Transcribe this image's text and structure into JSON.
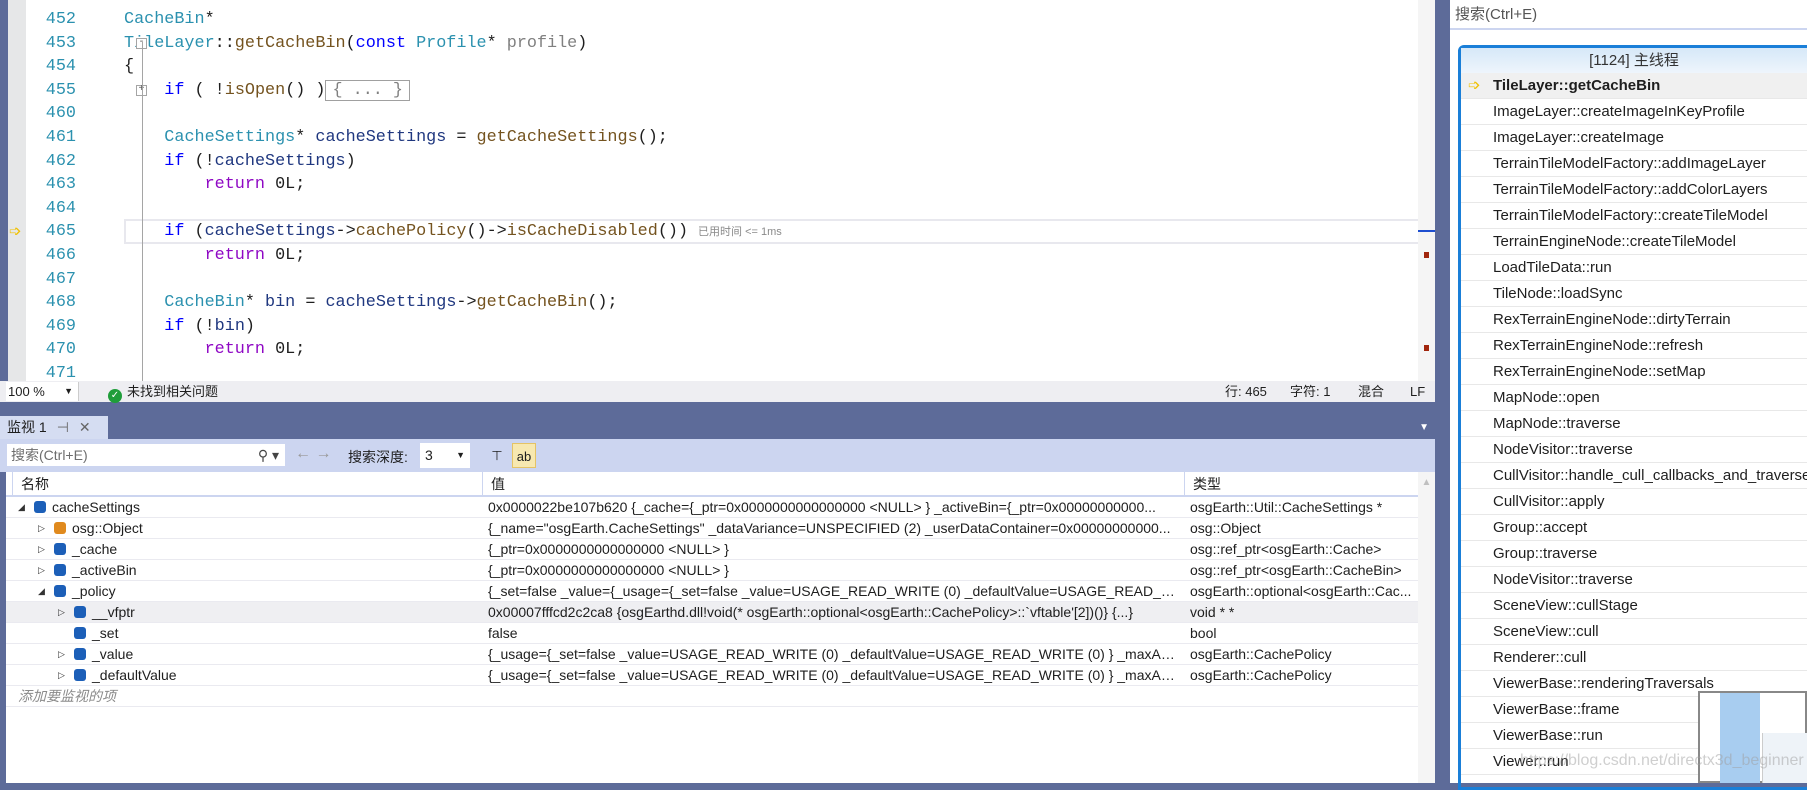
{
  "colors": {
    "accent": "#1a7fd8",
    "chrome": "#5d6b99",
    "toolbar": "#ccd5f0"
  },
  "editor": {
    "current_line": "465",
    "lines": [
      {
        "num": "452",
        "tokens": [
          {
            "t": "CacheBin",
            "c": "ty"
          },
          {
            "t": "*",
            "c": "pl"
          }
        ]
      },
      {
        "num": "453",
        "tokens": [
          {
            "t": "TileLayer",
            "c": "ty"
          },
          {
            "t": "::",
            "c": "pl"
          },
          {
            "t": "getCacheBin",
            "c": "fn"
          },
          {
            "t": "(",
            "c": "pl"
          },
          {
            "t": "const",
            "c": "kw"
          },
          {
            "t": " ",
            "c": "pl"
          },
          {
            "t": "Profile",
            "c": "ty"
          },
          {
            "t": "* ",
            "c": "pl"
          },
          {
            "t": "profile",
            "c": "pa"
          },
          {
            "t": ")",
            "c": "pl"
          }
        ]
      },
      {
        "num": "454",
        "tokens": [
          {
            "t": "{",
            "c": "pl"
          }
        ]
      },
      {
        "num": "455",
        "tokens": [
          {
            "t": "    ",
            "c": "pl"
          },
          {
            "t": "if",
            "c": "kw"
          },
          {
            "t": " ( !",
            "c": "pl"
          },
          {
            "t": "isOpen",
            "c": "fn"
          },
          {
            "t": "() )",
            "c": "pl"
          },
          {
            "t": "{ ... }",
            "c": "collapsed"
          }
        ]
      },
      {
        "num": "460",
        "tokens": []
      },
      {
        "num": "461",
        "tokens": [
          {
            "t": "    ",
            "c": "pl"
          },
          {
            "t": "CacheSettings",
            "c": "ty"
          },
          {
            "t": "* ",
            "c": "pl"
          },
          {
            "t": "cacheSettings",
            "c": "va"
          },
          {
            "t": " = ",
            "c": "pl"
          },
          {
            "t": "getCacheSettings",
            "c": "fn"
          },
          {
            "t": "();",
            "c": "pl"
          }
        ]
      },
      {
        "num": "462",
        "tokens": [
          {
            "t": "    ",
            "c": "pl"
          },
          {
            "t": "if",
            "c": "kw"
          },
          {
            "t": " (!",
            "c": "pl"
          },
          {
            "t": "cacheSettings",
            "c": "va"
          },
          {
            "t": ")",
            "c": "pl"
          }
        ]
      },
      {
        "num": "463",
        "tokens": [
          {
            "t": "        ",
            "c": "pl"
          },
          {
            "t": "return",
            "c": "rt"
          },
          {
            "t": " 0L;",
            "c": "pl"
          }
        ]
      },
      {
        "num": "464",
        "tokens": []
      },
      {
        "num": "465",
        "tokens": [
          {
            "t": "    ",
            "c": "pl"
          },
          {
            "t": "if",
            "c": "kw"
          },
          {
            "t": " (",
            "c": "pl"
          },
          {
            "t": "cacheSettings",
            "c": "va"
          },
          {
            "t": "->",
            "c": "pl"
          },
          {
            "t": "cachePolicy",
            "c": "fn"
          },
          {
            "t": "()->",
            "c": "pl"
          },
          {
            "t": "isCacheDisabled",
            "c": "fn"
          },
          {
            "t": "())",
            "c": "pl"
          },
          {
            "t": "已用时间 <= 1ms",
            "c": "hint"
          }
        ]
      },
      {
        "num": "466",
        "tokens": [
          {
            "t": "        ",
            "c": "pl"
          },
          {
            "t": "return",
            "c": "rt"
          },
          {
            "t": " 0L;",
            "c": "pl"
          }
        ]
      },
      {
        "num": "467",
        "tokens": []
      },
      {
        "num": "468",
        "tokens": [
          {
            "t": "    ",
            "c": "pl"
          },
          {
            "t": "CacheBin",
            "c": "ty"
          },
          {
            "t": "* ",
            "c": "pl"
          },
          {
            "t": "bin",
            "c": "va"
          },
          {
            "t": " = ",
            "c": "pl"
          },
          {
            "t": "cacheSettings",
            "c": "va"
          },
          {
            "t": "->",
            "c": "pl"
          },
          {
            "t": "getCacheBin",
            "c": "fn"
          },
          {
            "t": "();",
            "c": "pl"
          }
        ]
      },
      {
        "num": "469",
        "tokens": [
          {
            "t": "    ",
            "c": "pl"
          },
          {
            "t": "if",
            "c": "kw"
          },
          {
            "t": " (!",
            "c": "pl"
          },
          {
            "t": "bin",
            "c": "va"
          },
          {
            "t": ")",
            "c": "pl"
          }
        ]
      },
      {
        "num": "470",
        "tokens": [
          {
            "t": "        ",
            "c": "pl"
          },
          {
            "t": "return",
            "c": "rt"
          },
          {
            "t": " 0L;",
            "c": "pl"
          }
        ]
      },
      {
        "num": "471",
        "tokens": []
      }
    ]
  },
  "status": {
    "zoom": "100 %",
    "issues": "未找到相关问题",
    "line": "行: 465",
    "char": "字符: 1",
    "mode": "混合",
    "eol": "LF"
  },
  "watch": {
    "tab": "监视 1",
    "search_placeholder": "搜索(Ctrl+E)",
    "depth_label": "搜索深度:",
    "depth": "3",
    "columns": [
      "名称",
      "值",
      "类型"
    ],
    "rows": [
      {
        "level": 0,
        "exp": "open",
        "icon": "object",
        "name": "cacheSettings",
        "value": "0x0000022be107b620 {_cache={_ptr=0x0000000000000000 <NULL> } _activeBin={_ptr=0x00000000000...",
        "type": "osgEarth::Util::CacheSettings *"
      },
      {
        "level": 1,
        "exp": "closed",
        "icon": "base",
        "name": "osg::Object",
        "value": "{_name=\"osgEarth.CacheSettings\" _dataVariance=UNSPECIFIED (2) _userDataContainer=0x00000000000...",
        "type": "osg::Object"
      },
      {
        "level": 1,
        "exp": "closed",
        "icon": "field",
        "name": "_cache",
        "value": "{_ptr=0x0000000000000000 <NULL> }",
        "type": "osg::ref_ptr<osgEarth::Cache>"
      },
      {
        "level": 1,
        "exp": "closed",
        "icon": "field",
        "name": "_activeBin",
        "value": "{_ptr=0x0000000000000000 <NULL> }",
        "type": "osg::ref_ptr<osgEarth::CacheBin>"
      },
      {
        "level": 1,
        "exp": "open",
        "icon": "field",
        "name": "_policy",
        "value": "{_set=false _value={_usage={_set=false _value=USAGE_READ_WRITE (0) _defaultValue=USAGE_READ_W...",
        "type": "osgEarth::optional<osgEarth::Cac..."
      },
      {
        "level": 2,
        "exp": "closed",
        "icon": "object",
        "name": "__vfptr",
        "value": "0x00007fffcd2c2ca8 {osgEarthd.dll!void(* osgEarth::optional<osgEarth::CachePolicy>::`vftable'[2])()} {...}",
        "type": "void * *",
        "selected": true
      },
      {
        "level": 2,
        "exp": "none",
        "icon": "protected",
        "name": "_set",
        "value": "false",
        "type": "bool"
      },
      {
        "level": 2,
        "exp": "closed",
        "icon": "protected",
        "name": "_value",
        "value": "{_usage={_set=false _value=USAGE_READ_WRITE (0) _defaultValue=USAGE_READ_WRITE (0) } _maxAge...",
        "type": "osgEarth::CachePolicy"
      },
      {
        "level": 2,
        "exp": "closed",
        "icon": "protected",
        "name": "_defaultValue",
        "value": "{_usage={_set=false _value=USAGE_READ_WRITE (0) _defaultValue=USAGE_READ_WRITE (0) } _maxAge...",
        "type": "osgEarth::CachePolicy"
      }
    ],
    "add_item": "添加要监视的项"
  },
  "callstack": {
    "search_placeholder": "搜索(Ctrl+E)",
    "thread": "[1124] 主线程",
    "frames": [
      "TileLayer::getCacheBin",
      "ImageLayer::createImageInKeyProfile",
      "ImageLayer::createImage",
      "TerrainTileModelFactory::addImageLayer",
      "TerrainTileModelFactory::addColorLayers",
      "TerrainTileModelFactory::createTileModel",
      "TerrainEngineNode::createTileModel",
      "LoadTileData::run",
      "TileNode::loadSync",
      "RexTerrainEngineNode::dirtyTerrain",
      "RexTerrainEngineNode::refresh",
      "RexTerrainEngineNode::setMap",
      "MapNode::open",
      "MapNode::traverse",
      "NodeVisitor::traverse",
      "CullVisitor::handle_cull_callbacks_and_traverse",
      "CullVisitor::apply",
      "Group::accept",
      "Group::traverse",
      "NodeVisitor::traverse",
      "SceneView::cullStage",
      "SceneView::cull",
      "Renderer::cull",
      "ViewerBase::renderingTraversals",
      "ViewerBase::frame",
      "ViewerBase::run",
      "Viewer::run"
    ]
  },
  "watermark": "https://blog.csdn.net/directx3d_beginner"
}
